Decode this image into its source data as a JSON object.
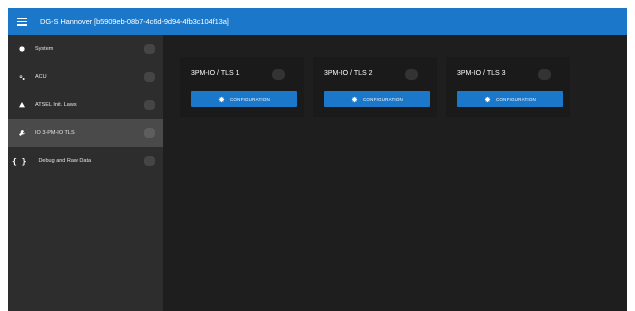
{
  "header": {
    "title": "DG-S Hannover [b5909eb-08b7-4c6d-9d94-4fb3c104f13a]",
    "menu_icon": "hamburger-menu-icon",
    "bar_color": "#1a77c9"
  },
  "sidebar": {
    "items": [
      {
        "label": "System",
        "icon": "gear-icon",
        "active": false
      },
      {
        "label": "ACU",
        "icon": "settings-icon",
        "active": false
      },
      {
        "label": "ATSEL Init. Laws",
        "icon": "tool-icon",
        "active": false
      },
      {
        "label": "IO 3-PM-IO TLS",
        "icon": "wrench-icon",
        "active": true
      },
      {
        "label": "Debug and Raw Data",
        "icon": "braces-icon",
        "active": false
      }
    ]
  },
  "main": {
    "cards": [
      {
        "title": "3PM-IO / TLS 1",
        "button_label": "CONFIGURATION"
      },
      {
        "title": "3PM-IO / TLS 2",
        "button_label": "CONFIGURATION"
      },
      {
        "title": "3PM-IO / TLS 3",
        "button_label": "CONFIGURATION"
      }
    ]
  }
}
